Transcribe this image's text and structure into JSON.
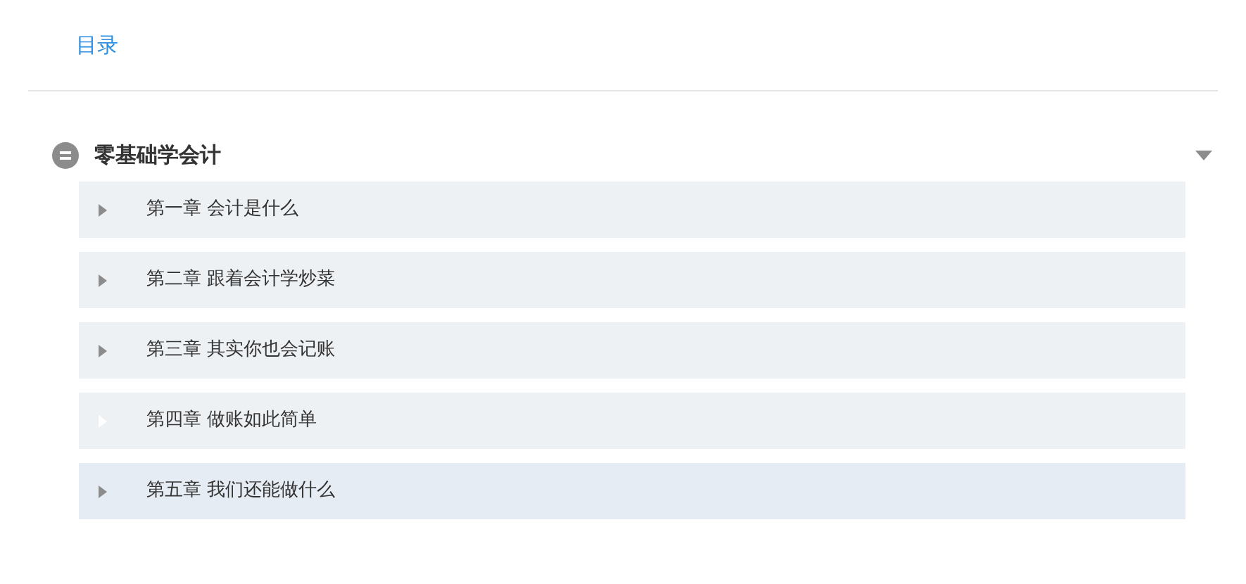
{
  "tab": {
    "label": "目录",
    "selected": true
  },
  "section": {
    "title": "零基础学会计",
    "expanded": true,
    "chapters": [
      {
        "label": "第一章 会计是什么",
        "hovered": false,
        "highlighted": false
      },
      {
        "label": "第二章 跟着会计学炒菜",
        "hovered": false,
        "highlighted": false
      },
      {
        "label": "第三章 其实你也会记账",
        "hovered": false,
        "highlighted": false
      },
      {
        "label": "第四章 做账如此简单",
        "hovered": false,
        "highlighted": true
      },
      {
        "label": "第五章 我们还能做什么",
        "hovered": true,
        "highlighted": false
      }
    ]
  }
}
